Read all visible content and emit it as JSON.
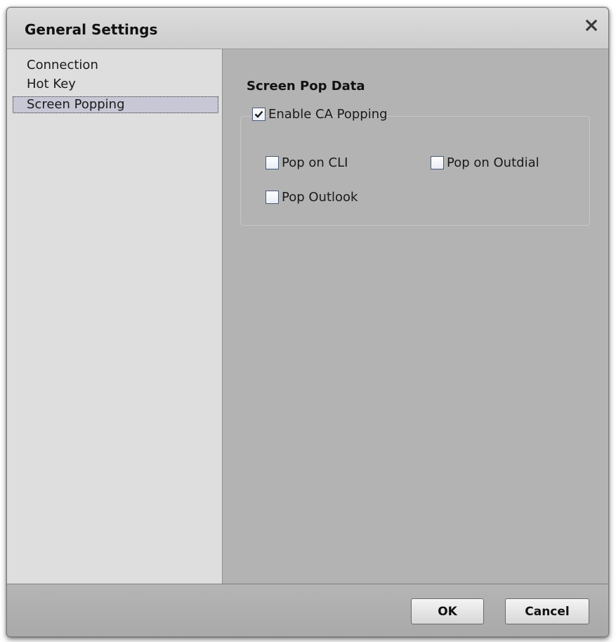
{
  "dialog": {
    "title": "General Settings",
    "close_icon": "close-icon"
  },
  "nav": {
    "items": [
      {
        "label": "Connection",
        "selected": false
      },
      {
        "label": "Hot Key",
        "selected": false
      },
      {
        "label": "Screen Popping",
        "selected": true
      }
    ]
  },
  "content": {
    "section_title": "Screen Pop Data",
    "enable_popping": {
      "label": "Enable CA Popping",
      "checked": true
    },
    "options": {
      "pop_on_cli": {
        "label": "Pop on CLI",
        "checked": false
      },
      "pop_on_outdial": {
        "label": "Pop on Outdial",
        "checked": false
      },
      "pop_outlook": {
        "label": "Pop Outlook",
        "checked": false
      }
    }
  },
  "footer": {
    "ok_label": "OK",
    "cancel_label": "Cancel"
  },
  "colors": {
    "dialog_bg": "#b3b3b3",
    "nav_bg": "#dedede",
    "selected_bg": "#c7c7d6",
    "checkbox_border": "#4a5a78"
  }
}
